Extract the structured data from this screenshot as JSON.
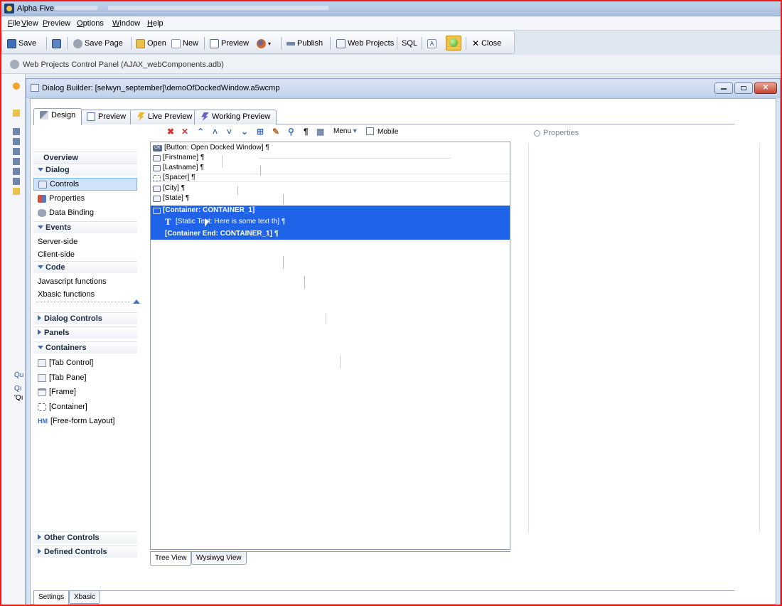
{
  "window": {
    "title": "Alpha Five"
  },
  "menu": [
    "File",
    "View",
    "Preview",
    "Options",
    "Window",
    "Help"
  ],
  "toolbar": {
    "save": "Save",
    "save_page": "Save Page",
    "open": "Open",
    "new": "New",
    "preview": "Preview",
    "publish": "Publish",
    "web_projects": "Web Projects",
    "sql": "SQL",
    "close": "Close"
  },
  "control_panel": {
    "title": "Web Projects Control Panel (AJAX_webComponents.adb)"
  },
  "underlying": {
    "q1": "Qu",
    "q2": "Qı",
    "q3": "'Qı"
  },
  "dialog": {
    "title": "Dialog Builder: [selwyn_september]\\demoOfDockedWindow.a5wcmp",
    "tabs": [
      "Design",
      "Preview",
      "Live Preview",
      "Working Preview"
    ]
  },
  "nav": {
    "overview": "Overview",
    "dialog": "Dialog",
    "controls": "Controls",
    "properties": "Properties",
    "data_binding": "Data Binding",
    "events": "Events",
    "server_side": "Server-side",
    "client_side": "Client-side",
    "code": "Code",
    "js_functions": "Javascript functions",
    "xbasic_functions": "Xbasic functions",
    "dialog_controls": "Dialog Controls",
    "panels": "Panels",
    "containers": "Containers",
    "tab_control": "[Tab Control]",
    "tab_pane": "[Tab Pane]",
    "frame": "[Frame]",
    "container": "[Container]",
    "freeform": "[Free-form Layout]",
    "other_controls": "Other Controls",
    "defined_controls": "Defined Controls"
  },
  "tree_tools": {
    "menu": "Menu",
    "mobile": "Mobile"
  },
  "tree": {
    "rows": [
      "[Button: Open Docked Window]",
      "[Firstname]",
      "[Lastname]",
      "[Spacer]",
      "[City]",
      "[State]",
      "[Container: CONTAINER_1]",
      "[Static Text: Here is some text th]",
      "[Container End: CONTAINER_1]"
    ],
    "pilcrow": "¶",
    "tabs": [
      "Tree View",
      "Wysiwyg View"
    ]
  },
  "properties": {
    "search_placeholder": "Properties"
  },
  "bottom_tabs": [
    "Settings",
    "Xbasic"
  ],
  "icons": {
    "save": "save-icon",
    "open": "folder-open-icon",
    "new": "new-document-icon",
    "preview": "preview-icon",
    "firefox": "firefox-icon",
    "close": "close-icon"
  },
  "colors": {
    "selection": "#1f63e8",
    "frame_border": "#e41c1c",
    "window_chrome": "#c2d4ec"
  }
}
